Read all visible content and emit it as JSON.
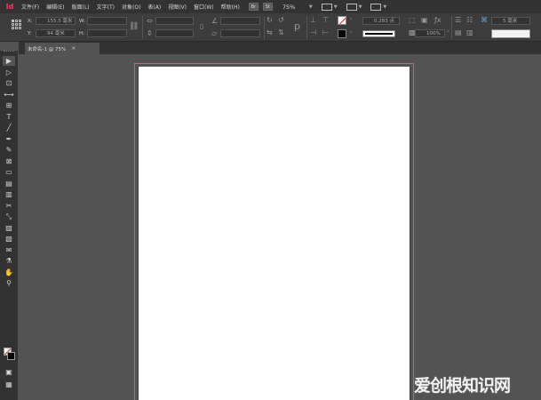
{
  "app": {
    "logo": "Id"
  },
  "menu": {
    "items": [
      "文件(F)",
      "编辑(E)",
      "版面(L)",
      "文字(T)",
      "对象(O)",
      "表(A)",
      "视图(V)",
      "窗口(W)",
      "帮助(H)"
    ],
    "bridge_label": "Br",
    "stock_label": "St",
    "zoom": "75%"
  },
  "control_panel": {
    "x_label": "X:",
    "x_value": "155.5 毫米",
    "y_label": "Y:",
    "y_value": "94 毫米",
    "w_label": "W:",
    "h_label": "H:",
    "stroke_weight": "0.283 点",
    "opacity": "100%",
    "offset": "5 毫米"
  },
  "document": {
    "tab_title": "未命名-1 @ 75%",
    "close_glyph": "×"
  },
  "toolbox": {
    "tools": [
      {
        "name": "selection-tool",
        "glyph": "▶",
        "active": true
      },
      {
        "name": "direct-selection-tool",
        "glyph": "▷"
      },
      {
        "name": "page-tool",
        "glyph": "⊡"
      },
      {
        "name": "gap-tool",
        "glyph": "⟷"
      },
      {
        "name": "content-collector-tool",
        "glyph": "⊞"
      },
      {
        "name": "type-tool",
        "glyph": "T"
      },
      {
        "name": "line-tool",
        "glyph": "╱"
      },
      {
        "name": "pen-tool",
        "glyph": "✒"
      },
      {
        "name": "pencil-tool",
        "glyph": "✎"
      },
      {
        "name": "rectangle-frame-tool",
        "glyph": "⊠"
      },
      {
        "name": "rectangle-tool",
        "glyph": "▭"
      },
      {
        "name": "horizontal-grid-tool",
        "glyph": "▤"
      },
      {
        "name": "vertical-grid-tool",
        "glyph": "▥"
      },
      {
        "name": "scissors-tool",
        "glyph": "✂"
      },
      {
        "name": "free-transform-tool",
        "glyph": "⤡"
      },
      {
        "name": "gradient-swatch-tool",
        "glyph": "▨"
      },
      {
        "name": "gradient-feather-tool",
        "glyph": "▧"
      },
      {
        "name": "note-tool",
        "glyph": "✉"
      },
      {
        "name": "eyedropper-tool",
        "glyph": "⚗"
      },
      {
        "name": "hand-tool",
        "glyph": "✋"
      },
      {
        "name": "zoom-tool",
        "glyph": "⚲"
      }
    ],
    "bottom": [
      {
        "name": "normal-mode-button",
        "glyph": "▣"
      },
      {
        "name": "screen-mode-button",
        "glyph": "▦"
      }
    ]
  },
  "watermark": "爱创根知识网",
  "colors": {
    "menubar_bg": "#323232",
    "control_bg": "#3c3c3c",
    "pasteboard": "#535353",
    "page": "#ffffff",
    "bleed_guide": "#d45a7a",
    "accent": "#ff3366"
  }
}
